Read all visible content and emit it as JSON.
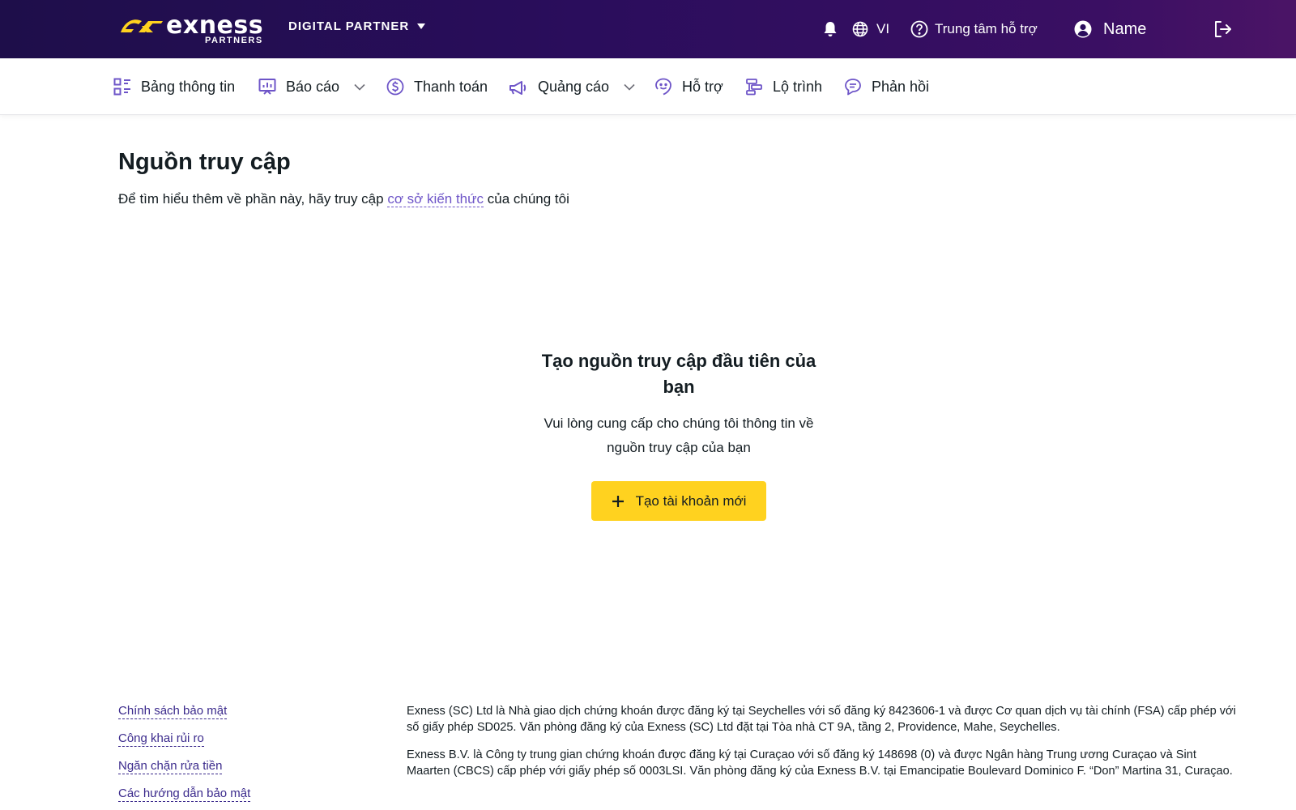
{
  "header": {
    "logo_text": "exness",
    "logo_sub": "PARTNERS",
    "partner_type": "DIGITAL PARTNER",
    "language": "VI",
    "help_center": "Trung tâm hỗ trợ",
    "user_name": "Name",
    "colors": {
      "gradient_start": "#1e0e4a",
      "gradient_end": "#4b1466",
      "logo_accent": "#ffd21f"
    }
  },
  "nav": {
    "items": [
      {
        "label": "Bảng thông tin",
        "icon": "dashboard-icon"
      },
      {
        "label": "Báo cáo",
        "icon": "reports-icon",
        "has_dropdown": true
      },
      {
        "label": "Thanh toán",
        "icon": "dollar-icon"
      },
      {
        "label": "Quảng cáo",
        "icon": "megaphone-icon",
        "has_dropdown": true
      },
      {
        "label": "Hỗ trợ",
        "icon": "support-face-icon"
      },
      {
        "label": "Lộ trình",
        "icon": "roadmap-icon"
      },
      {
        "label": "Phản hồi",
        "icon": "feedback-icon"
      }
    ],
    "icon_color": "#6e55c8"
  },
  "main": {
    "title": "Nguồn truy cập",
    "intro_before": "Để tìm hiểu thêm về phần này, hãy truy cập ",
    "intro_link": "cơ sở kiến thức",
    "intro_after": " của chúng tôi",
    "empty_title": "Tạo nguồn truy cập đầu tiên của bạn",
    "empty_desc": "Vui lòng cung cấp cho chúng tôi thông tin về nguồn truy cập của bạn",
    "cta_label": "Tạo tài khoản mới",
    "cta_color": "#ffd21f"
  },
  "footer": {
    "links": [
      "Chính sách bảo mật",
      "Công khai rủi ro",
      "Ngăn chặn rửa tiền",
      "Các hướng dẫn bảo mật"
    ],
    "paragraphs": [
      "Exness (SC) Ltd là Nhà giao dịch chứng khoán được đăng ký tại Seychelles với số đăng ký 8423606-1 và được Cơ quan dịch vụ tài chính (FSA) cấp phép với số giấy phép SD025. Văn phòng đăng ký của Exness (SC) Ltd đặt tại Tòa nhà CT 9A, tầng 2, Providence, Mahe, Seychelles.",
      "Exness B.V. là Công ty trung gian chứng khoán được đăng ký tại Curaçao với số đăng ký 148698 (0) và được Ngân hàng Trung ương Curaçao và Sint Maarten (CBCS) cấp phép với giấy phép số 0003LSI. Văn phòng đăng ký của Exness B.V. tại Emancipatie Boulevard Dominico F. “Don” Martina 31, Curaçao."
    ]
  }
}
